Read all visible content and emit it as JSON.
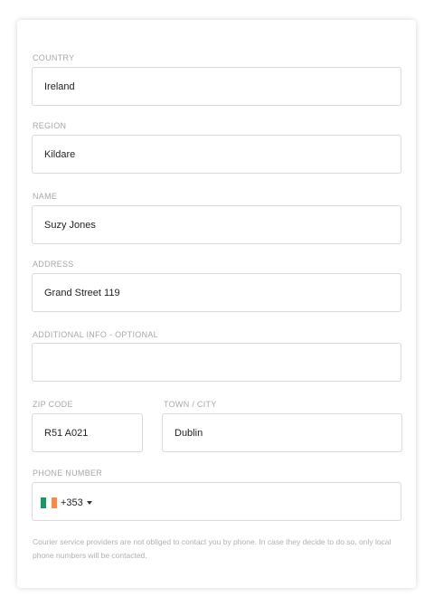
{
  "form": {
    "country": {
      "label": "COUNTRY",
      "value": "Ireland"
    },
    "region": {
      "label": "REGION",
      "value": "Kildare"
    },
    "name": {
      "label": "NAME",
      "value": "Suzy Jones"
    },
    "address": {
      "label": "ADDRESS",
      "value": "Grand Street 119"
    },
    "additional_info": {
      "label": "ADDITIONAL INFO - OPTIONAL",
      "value": ""
    },
    "zip": {
      "label": "ZIP CODE",
      "value": "R51 A021"
    },
    "town": {
      "label": "TOWN / CITY",
      "value": "Dublin"
    },
    "phone": {
      "label": "PHONE NUMBER",
      "flag_icon": "ireland-flag-icon",
      "dial_code": "+353",
      "value": ""
    },
    "note": "Courier service providers are not obliged to contact you by phone. In case they decide to do so, only local phone numbers will be contacted."
  },
  "colors": {
    "border": "#d9d9d9",
    "label": "#a8a8a8",
    "text": "#222222",
    "flag_green": "#169b62",
    "flag_white": "#ffffff",
    "flag_orange": "#ff883e"
  }
}
